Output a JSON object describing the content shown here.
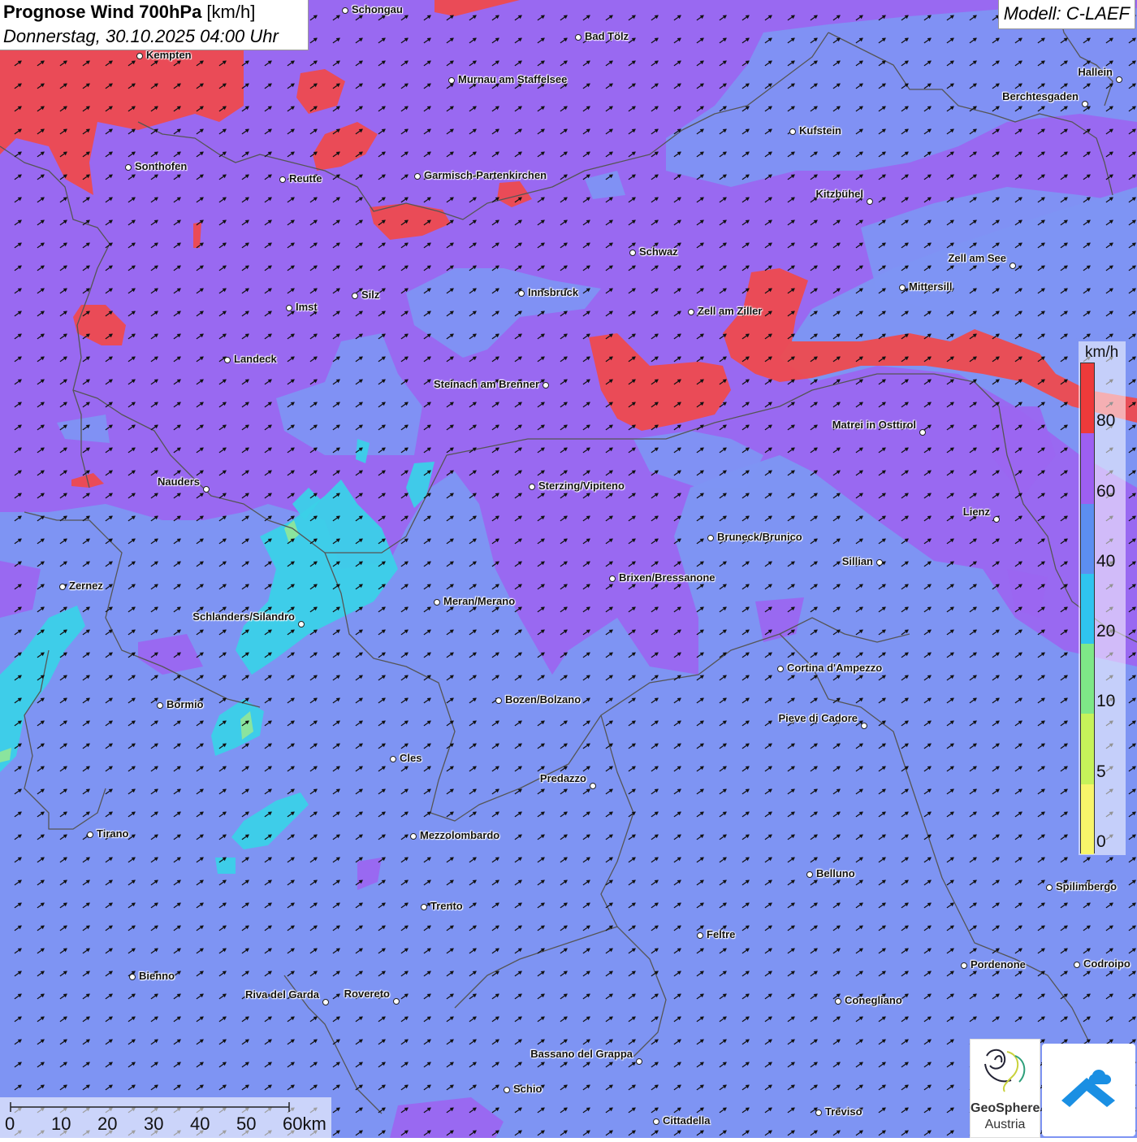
{
  "header": {
    "title_bold": "Prognose Wind 700hPa",
    "title_unit": " [km/h]",
    "datetime": "Donnerstag, 30.10.2025 04:00 Uhr",
    "model": "Modell: C-LAEF"
  },
  "legend": {
    "unit": "km/h",
    "ticks": [
      "80",
      "60",
      "40",
      "20",
      "10",
      "5",
      "0"
    ],
    "colors": [
      "#ee3a3a",
      "#9d5ff2",
      "#5c8ef1",
      "#2fc4ef",
      "#7ee887",
      "#c6f25a",
      "#f8f56a"
    ]
  },
  "scale_bar": {
    "labels": [
      "0",
      "10",
      "20",
      "30",
      "40",
      "50",
      "60km"
    ]
  },
  "logos": {
    "geosphere_line1": "GeoSphere",
    "geosphere_line2": "Austria"
  },
  "map": {
    "colors": {
      "strong_80": "#ee4a4e",
      "band_60": "#9b66f0",
      "band_40": "#7e94f3",
      "band_20": "#3bd0e8",
      "band_10": "#8ee59a",
      "border": "#555555",
      "arrow": "#111111"
    },
    "wind_direction": "southwest"
  },
  "cities": [
    {
      "name": "Schongau",
      "side": "r"
    },
    {
      "name": "Bad Tölz",
      "side": "r"
    },
    {
      "name": "Kempten",
      "side": "r"
    },
    {
      "name": "Murnau am Staffelsee",
      "side": "r"
    },
    {
      "name": "Hallein",
      "side": "ul"
    },
    {
      "name": "Berchtesgaden",
      "side": "ul"
    },
    {
      "name": "Kufstein",
      "side": "r"
    },
    {
      "name": "Sonthofen",
      "side": "r"
    },
    {
      "name": "Reutte",
      "side": "r"
    },
    {
      "name": "Garmisch-Partenkirchen",
      "side": "r"
    },
    {
      "name": "Kitzbühel",
      "side": "ul"
    },
    {
      "name": "Schwaz",
      "side": "r"
    },
    {
      "name": "Zell am See",
      "side": "ul"
    },
    {
      "name": "Innsbruck",
      "side": "r"
    },
    {
      "name": "Mittersill",
      "side": "r"
    },
    {
      "name": "Imst",
      "side": "r"
    },
    {
      "name": "Silz",
      "side": "r"
    },
    {
      "name": "Zell am Ziller",
      "side": "r"
    },
    {
      "name": "Landeck",
      "side": "r"
    },
    {
      "name": "Steinach am Brenner",
      "side": "l"
    },
    {
      "name": "Matrei in Osttirol",
      "side": "ul"
    },
    {
      "name": "Nauders",
      "side": "ul"
    },
    {
      "name": "Sterzing/Vipiteno",
      "side": "r"
    },
    {
      "name": "Lienz",
      "side": "ul"
    },
    {
      "name": "Bruneck/Brunico",
      "side": "r"
    },
    {
      "name": "Sillian",
      "side": "l"
    },
    {
      "name": "Brixen/Bressanone",
      "side": "r"
    },
    {
      "name": "Zernez",
      "side": "r"
    },
    {
      "name": "Meran/Merano",
      "side": "r"
    },
    {
      "name": "Schlanders/Silandro",
      "side": "ul"
    },
    {
      "name": "Cortina d'Ampezzo",
      "side": "r"
    },
    {
      "name": "Bozen/Bolzano",
      "side": "r"
    },
    {
      "name": "Bormio",
      "side": "r"
    },
    {
      "name": "Pieve di Cadore",
      "side": "ul"
    },
    {
      "name": "Cles",
      "side": "r"
    },
    {
      "name": "Predazzo",
      "side": "ul"
    },
    {
      "name": "Tirano",
      "side": "r"
    },
    {
      "name": "Mezzolombardo",
      "side": "r"
    },
    {
      "name": "Belluno",
      "side": "r"
    },
    {
      "name": "Spilimbergo",
      "side": "r"
    },
    {
      "name": "Trento",
      "side": "r"
    },
    {
      "name": "Feltre",
      "side": "r"
    },
    {
      "name": "Pordenone",
      "side": "r"
    },
    {
      "name": "Codroipo",
      "side": "r"
    },
    {
      "name": "Bienno",
      "side": "r"
    },
    {
      "name": "Riva del Garda",
      "side": "ul"
    },
    {
      "name": "Rovereto",
      "side": "ul"
    },
    {
      "name": "Conegliano",
      "side": "r"
    },
    {
      "name": "Bassano del Grappa",
      "side": "ul"
    },
    {
      "name": "Schio",
      "side": "r"
    },
    {
      "name": "Treviso",
      "side": "r"
    },
    {
      "name": "Cittadella",
      "side": "r"
    }
  ]
}
